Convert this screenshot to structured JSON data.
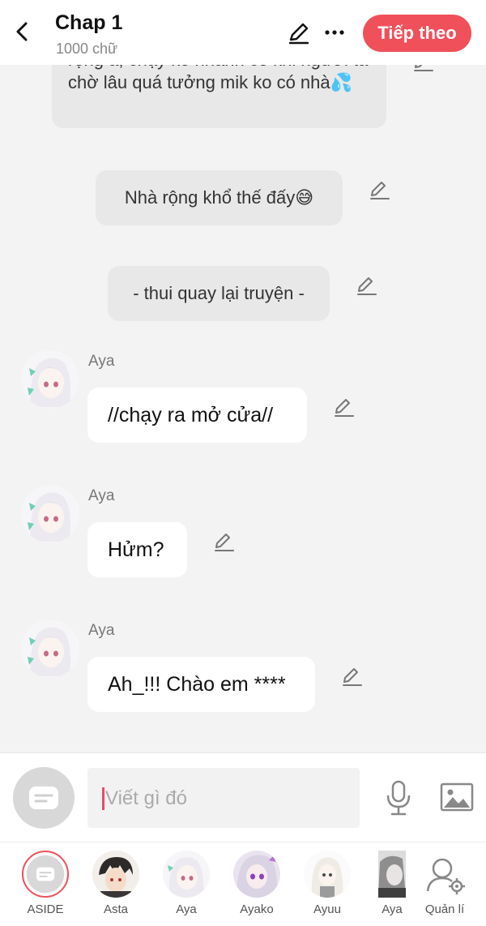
{
  "header": {
    "title": "Chap 1",
    "subtitle": "1000 chữ",
    "next_label": "Tiếp theo"
  },
  "messages": [
    {
      "type": "narration",
      "text": "rộng á, chạy ko nhanh có khi người ta chờ lâu quá tưởng mik ko có nhà💦"
    },
    {
      "type": "narration",
      "text": "Nhà rộng khổ thế đấy😅"
    },
    {
      "type": "narration",
      "text": "- thui quay lại truyện -"
    },
    {
      "type": "character",
      "name": "Aya",
      "text": "//chạy ra mở cửa//"
    },
    {
      "type": "character",
      "name": "Aya",
      "text": "Hửm?"
    },
    {
      "type": "character",
      "name": "Aya",
      "text": "Ah_!!! Chào em ****"
    }
  ],
  "composer": {
    "placeholder": "Viết gì đó"
  },
  "characters": [
    {
      "label": "ASIDE"
    },
    {
      "label": "Asta"
    },
    {
      "label": "Aya"
    },
    {
      "label": "Ayako"
    },
    {
      "label": "Ayuu"
    },
    {
      "label": "Aya"
    },
    {
      "label": "Quản lí"
    }
  ],
  "colors": {
    "accent": "#f0505a",
    "caret": "#e94a6b",
    "background": "#f3f3f3"
  }
}
